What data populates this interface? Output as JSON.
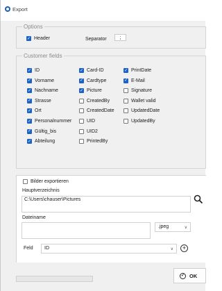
{
  "window": {
    "title": "Export"
  },
  "options": {
    "legend": "Options",
    "header_label": "Header",
    "header_checked": true,
    "separator_label": "Separator",
    "separator_value": ";"
  },
  "customer_fields": {
    "legend": "Customer fields",
    "columns": [
      [
        {
          "label": "ID",
          "checked": true
        },
        {
          "label": "Vorname",
          "checked": true
        },
        {
          "label": "Nachname",
          "checked": true
        },
        {
          "label": "Strasse",
          "checked": true
        },
        {
          "label": "Ort",
          "checked": true
        },
        {
          "label": "Personalnummer",
          "checked": true
        },
        {
          "label": "Gültig_bis",
          "checked": true
        },
        {
          "label": "Abteilung",
          "checked": true
        }
      ],
      [
        {
          "label": "Card-ID",
          "checked": true
        },
        {
          "label": "Cardtype",
          "checked": true
        },
        {
          "label": "Picture",
          "checked": true
        },
        {
          "label": "CreatedBy",
          "checked": false
        },
        {
          "label": "CreatedDate",
          "checked": false
        },
        {
          "label": "UID",
          "checked": false
        },
        {
          "label": "UID2",
          "checked": false
        },
        {
          "label": "PrintedBy",
          "checked": false
        }
      ],
      [
        {
          "label": "PrintDate",
          "checked": true
        },
        {
          "label": "E-Mail",
          "checked": true
        },
        {
          "label": "Signature",
          "checked": false
        },
        {
          "label": "Wallet valid",
          "checked": false
        },
        {
          "label": "UpdatedDate",
          "checked": false
        },
        {
          "label": "UpdatedBy",
          "checked": false
        }
      ]
    ]
  },
  "images": {
    "export_label": "Bilder exportieren",
    "export_checked": false,
    "root_dir_label": "Hauptverzeichnis",
    "root_dir_value": "C:\\Users\\chauser\\Pictures",
    "filename_label": "Dateiname",
    "filename_value": "",
    "format_value": ".jpeg",
    "field_label": "Feld",
    "field_value": "ID"
  },
  "footer": {
    "ok_label": "OK"
  }
}
